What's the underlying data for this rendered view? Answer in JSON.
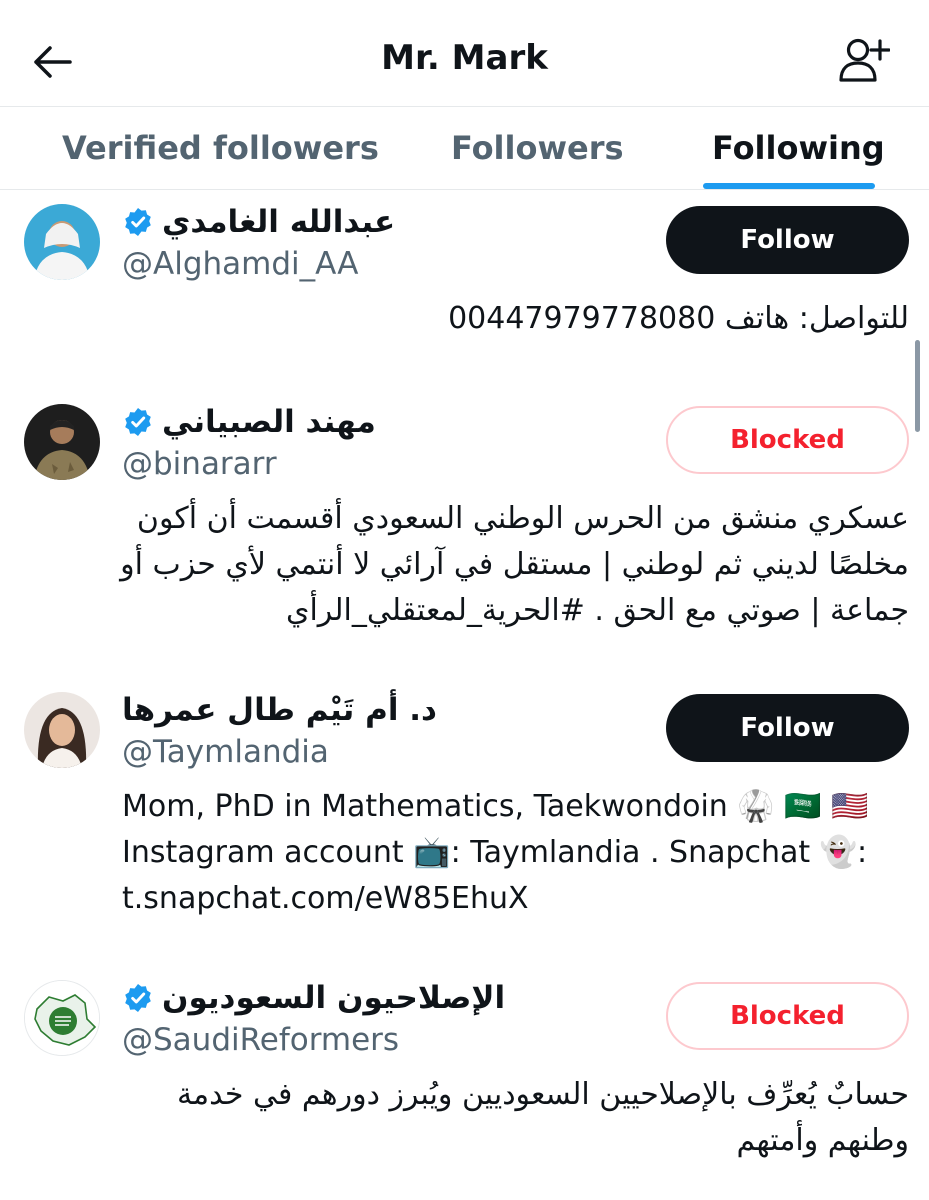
{
  "header": {
    "title": "Mr. Mark",
    "back_icon": "arrow-left-icon",
    "add_user_icon": "person-plus-icon"
  },
  "tabs": [
    {
      "label": "Verified followers",
      "active": false
    },
    {
      "label": "Followers",
      "active": false
    },
    {
      "label": "Following",
      "active": true
    }
  ],
  "users": [
    {
      "name": "عبدالله الغامدي",
      "handle": "@Alghamdi_AA",
      "verified": true,
      "button": "Follow",
      "bio": "للتواصل: هاتف 00447979778080"
    },
    {
      "name": "مهند الصبياني",
      "handle": "@binararr",
      "verified": true,
      "button": "Blocked",
      "bio": "عسكري منشق من الحرس الوطني السعودي أقسمت أن أكون مخلصًا لديني ثم لوطني | مستقل في آرائي لا أنتمي لأي حزب أو جماعة | صوتي مع الحق . #الحرية_لمعتقلي_الرأي"
    },
    {
      "name": "د. أم تَيْم طال عمرها",
      "handle": "@Taymlandia",
      "verified": false,
      "button": "Follow",
      "bio": "Mom, PhD in Mathematics, Taekwondoin 🥋 🇸🇦 🇺🇸 Instagram account 📺: Taymlandia . Snapchat 👻: t.snapchat.com/eW85EhuX"
    },
    {
      "name": "الإصلاحيون السعوديون",
      "handle": "@SaudiReformers",
      "verified": true,
      "button": "Blocked",
      "bio": "حسابٌ يُعرِّف بالإصلاحيين السعوديين ويُبرز دورهم في خدمة وطنهم وأمتهم"
    }
  ],
  "colors": {
    "accent": "#1d9bf0",
    "follow_bg": "#0f1419",
    "blocked_text": "#f4212e",
    "blocked_border": "#fdc9ce",
    "secondary_text": "#536471"
  }
}
